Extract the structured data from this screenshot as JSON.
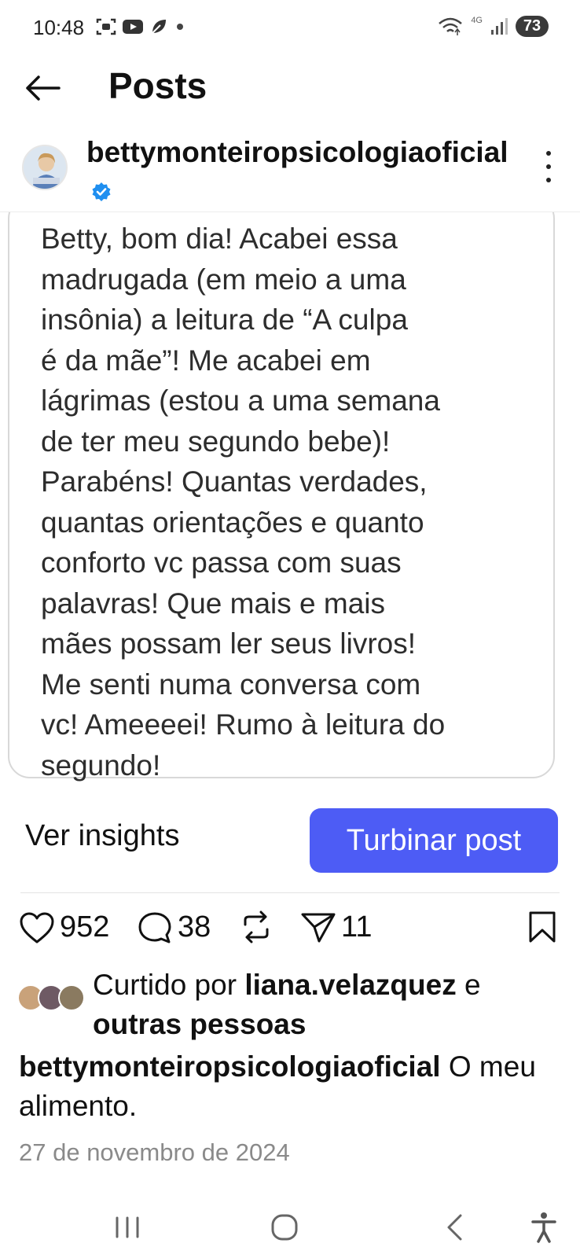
{
  "status_bar": {
    "time": "10:48",
    "network": "4G",
    "battery": "73",
    "icons": [
      "screenshot-icon",
      "youtube-icon",
      "leaf-icon",
      "dot-icon",
      "wifi-icon",
      "signal-icon"
    ]
  },
  "header": {
    "title": "Posts",
    "back_icon": "arrow-left-icon"
  },
  "profile": {
    "username": "bettymonteiropsicologiaoficial",
    "verified": true,
    "more_icon": "more-vertical-icon"
  },
  "post": {
    "image_text": [
      "Betty, bom dia! Acabei essa",
      "madrugada (em meio a uma",
      "insônia) a leitura de “A culpa",
      "é da mãe”! Me acabei em",
      "lágrimas (estou a uma semana",
      "de ter meu segundo bebe)!",
      "Parabéns! Quantas verdades,",
      "quantas orientações e quanto",
      "conforto vc passa com suas",
      "palavras! Que mais e mais",
      "mães possam ler seus livros!",
      "Me senti numa conversa com",
      "vc! Ameeeei! Rumo à leitura do",
      "segundo!"
    ]
  },
  "actions": {
    "insights_label": "Ver insights",
    "boost_label": "Turbinar post",
    "boost_color": "#4d5cf5"
  },
  "stats": {
    "likes": "952",
    "comments": "38",
    "shares": "11"
  },
  "liked_by": {
    "prefix": "Curtido por ",
    "user": "liana.velazquez",
    "connector": " e",
    "others": "outras pessoas"
  },
  "caption": {
    "user": "bettymonteiropsicologiaoficial",
    "text": " O meu alimento."
  },
  "date": "27 de novembro de 2024",
  "nav": {
    "items": [
      "recent-apps-icon",
      "home-icon",
      "back-icon",
      "accessibility-icon"
    ]
  }
}
